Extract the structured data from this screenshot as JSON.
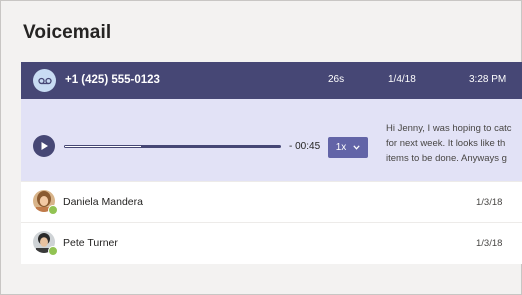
{
  "page": {
    "title": "Voicemail"
  },
  "selected": {
    "phone": "+1 (425) 555-0123",
    "duration": "26s",
    "date": "1/4/18",
    "time": "3:28 PM",
    "icon": "voicemail-icon"
  },
  "player": {
    "play_icon": "play-icon",
    "progress": 0.35,
    "remaining": "- 00:45",
    "speed": "1x",
    "transcript": "Hi Jenny, I was hoping to catc\nfor next week. It looks like th\nitems to be done. Anyways g"
  },
  "items": [
    {
      "name": "Daniela Mandera",
      "date": "1/3/18",
      "status": "available"
    },
    {
      "name": "Pete Turner",
      "date": "1/3/18",
      "status": "available"
    }
  ],
  "colors": {
    "header": "#464775",
    "player_bg": "#e2e2f6",
    "accent": "#6264a7",
    "presence": "#92c353"
  }
}
